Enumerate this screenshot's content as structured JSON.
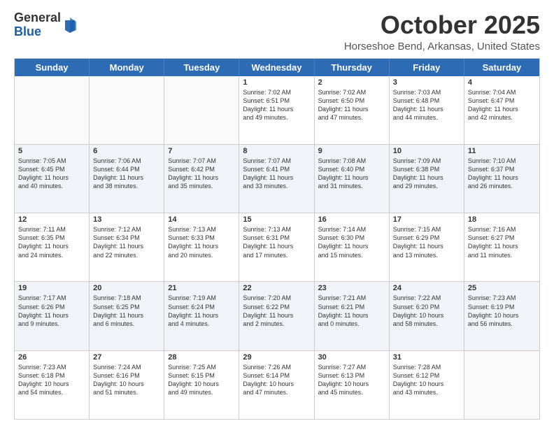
{
  "logo": {
    "general": "General",
    "blue": "Blue"
  },
  "title": "October 2025",
  "location": "Horseshoe Bend, Arkansas, United States",
  "days_of_week": [
    "Sunday",
    "Monday",
    "Tuesday",
    "Wednesday",
    "Thursday",
    "Friday",
    "Saturday"
  ],
  "weeks": [
    [
      {
        "day": "",
        "info": ""
      },
      {
        "day": "",
        "info": ""
      },
      {
        "day": "",
        "info": ""
      },
      {
        "day": "1",
        "info": "Sunrise: 7:02 AM\nSunset: 6:51 PM\nDaylight: 11 hours\nand 49 minutes."
      },
      {
        "day": "2",
        "info": "Sunrise: 7:02 AM\nSunset: 6:50 PM\nDaylight: 11 hours\nand 47 minutes."
      },
      {
        "day": "3",
        "info": "Sunrise: 7:03 AM\nSunset: 6:48 PM\nDaylight: 11 hours\nand 44 minutes."
      },
      {
        "day": "4",
        "info": "Sunrise: 7:04 AM\nSunset: 6:47 PM\nDaylight: 11 hours\nand 42 minutes."
      }
    ],
    [
      {
        "day": "5",
        "info": "Sunrise: 7:05 AM\nSunset: 6:45 PM\nDaylight: 11 hours\nand 40 minutes."
      },
      {
        "day": "6",
        "info": "Sunrise: 7:06 AM\nSunset: 6:44 PM\nDaylight: 11 hours\nand 38 minutes."
      },
      {
        "day": "7",
        "info": "Sunrise: 7:07 AM\nSunset: 6:42 PM\nDaylight: 11 hours\nand 35 minutes."
      },
      {
        "day": "8",
        "info": "Sunrise: 7:07 AM\nSunset: 6:41 PM\nDaylight: 11 hours\nand 33 minutes."
      },
      {
        "day": "9",
        "info": "Sunrise: 7:08 AM\nSunset: 6:40 PM\nDaylight: 11 hours\nand 31 minutes."
      },
      {
        "day": "10",
        "info": "Sunrise: 7:09 AM\nSunset: 6:38 PM\nDaylight: 11 hours\nand 29 minutes."
      },
      {
        "day": "11",
        "info": "Sunrise: 7:10 AM\nSunset: 6:37 PM\nDaylight: 11 hours\nand 26 minutes."
      }
    ],
    [
      {
        "day": "12",
        "info": "Sunrise: 7:11 AM\nSunset: 6:35 PM\nDaylight: 11 hours\nand 24 minutes."
      },
      {
        "day": "13",
        "info": "Sunrise: 7:12 AM\nSunset: 6:34 PM\nDaylight: 11 hours\nand 22 minutes."
      },
      {
        "day": "14",
        "info": "Sunrise: 7:13 AM\nSunset: 6:33 PM\nDaylight: 11 hours\nand 20 minutes."
      },
      {
        "day": "15",
        "info": "Sunrise: 7:13 AM\nSunset: 6:31 PM\nDaylight: 11 hours\nand 17 minutes."
      },
      {
        "day": "16",
        "info": "Sunrise: 7:14 AM\nSunset: 6:30 PM\nDaylight: 11 hours\nand 15 minutes."
      },
      {
        "day": "17",
        "info": "Sunrise: 7:15 AM\nSunset: 6:29 PM\nDaylight: 11 hours\nand 13 minutes."
      },
      {
        "day": "18",
        "info": "Sunrise: 7:16 AM\nSunset: 6:27 PM\nDaylight: 11 hours\nand 11 minutes."
      }
    ],
    [
      {
        "day": "19",
        "info": "Sunrise: 7:17 AM\nSunset: 6:26 PM\nDaylight: 11 hours\nand 9 minutes."
      },
      {
        "day": "20",
        "info": "Sunrise: 7:18 AM\nSunset: 6:25 PM\nDaylight: 11 hours\nand 6 minutes."
      },
      {
        "day": "21",
        "info": "Sunrise: 7:19 AM\nSunset: 6:24 PM\nDaylight: 11 hours\nand 4 minutes."
      },
      {
        "day": "22",
        "info": "Sunrise: 7:20 AM\nSunset: 6:22 PM\nDaylight: 11 hours\nand 2 minutes."
      },
      {
        "day": "23",
        "info": "Sunrise: 7:21 AM\nSunset: 6:21 PM\nDaylight: 11 hours\nand 0 minutes."
      },
      {
        "day": "24",
        "info": "Sunrise: 7:22 AM\nSunset: 6:20 PM\nDaylight: 10 hours\nand 58 minutes."
      },
      {
        "day": "25",
        "info": "Sunrise: 7:23 AM\nSunset: 6:19 PM\nDaylight: 10 hours\nand 56 minutes."
      }
    ],
    [
      {
        "day": "26",
        "info": "Sunrise: 7:23 AM\nSunset: 6:18 PM\nDaylight: 10 hours\nand 54 minutes."
      },
      {
        "day": "27",
        "info": "Sunrise: 7:24 AM\nSunset: 6:16 PM\nDaylight: 10 hours\nand 51 minutes."
      },
      {
        "day": "28",
        "info": "Sunrise: 7:25 AM\nSunset: 6:15 PM\nDaylight: 10 hours\nand 49 minutes."
      },
      {
        "day": "29",
        "info": "Sunrise: 7:26 AM\nSunset: 6:14 PM\nDaylight: 10 hours\nand 47 minutes."
      },
      {
        "day": "30",
        "info": "Sunrise: 7:27 AM\nSunset: 6:13 PM\nDaylight: 10 hours\nand 45 minutes."
      },
      {
        "day": "31",
        "info": "Sunrise: 7:28 AM\nSunset: 6:12 PM\nDaylight: 10 hours\nand 43 minutes."
      },
      {
        "day": "",
        "info": ""
      }
    ]
  ]
}
